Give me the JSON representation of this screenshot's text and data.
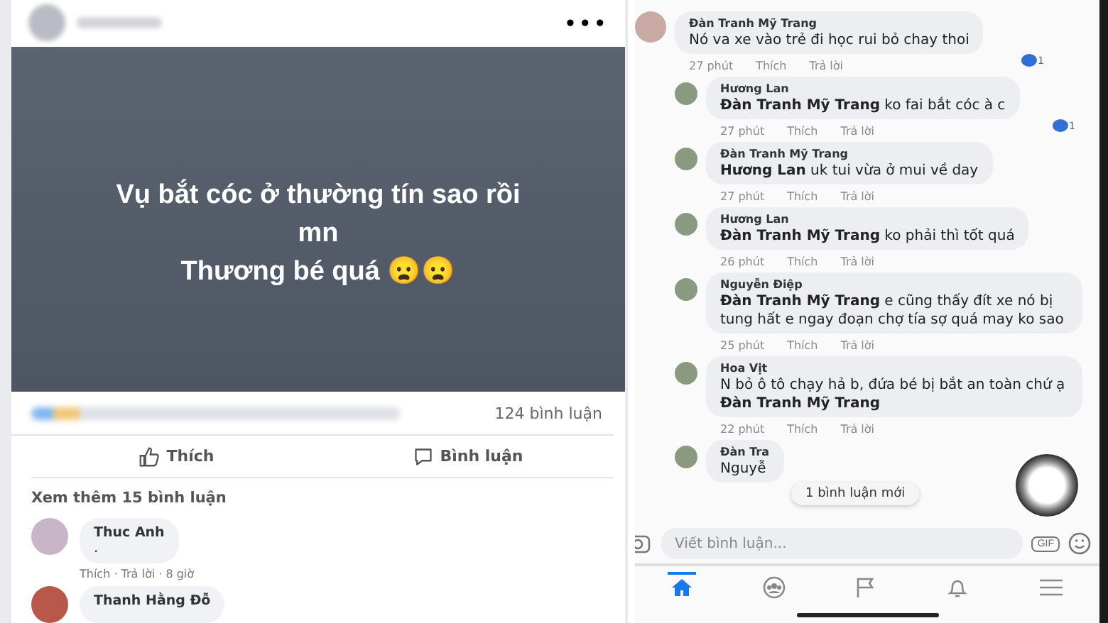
{
  "post": {
    "menu": "•••",
    "text_lines": [
      "Vụ bắt cóc ở thường tín sao rồi",
      "mn",
      "Thương bé quá 😦😦"
    ],
    "comment_count": "124 bình luận",
    "actions": [
      {
        "kind": "like",
        "label": "Thích"
      },
      {
        "kind": "comment",
        "label": "Bình luận"
      }
    ],
    "more_comments": "Xem thêm 15 bình luận",
    "comments": [
      {
        "name": "Thuc Anh",
        "text": ".",
        "meta": "Thích · Trả lời · 8 giờ"
      },
      {
        "name": "Thanh Hằng Đỗ"
      }
    ]
  },
  "thread": {
    "comments": [
      {
        "name": "Đàn Tranh Mỹ Trang",
        "text": "Nó va xe vào trẻ đi học rui bỏ chay thoi",
        "time": "27 phút",
        "like": "Thích",
        "reply": "Trả lời",
        "reactions": "1",
        "children": [
          {
            "name": "Hương Lan",
            "text": "**Đàn Tranh Mỹ Trang** ko fai bắt cóc à c",
            "time": "27 phút",
            "like": "Thích",
            "reply": "Trả lời",
            "reactions": "1"
          },
          {
            "name": "Đàn Tranh Mỹ Trang",
            "text": "**Hương Lan** uk tui vừa ở mui về day",
            "time": "27 phút",
            "like": "Thích",
            "reply": "Trả lời"
          },
          {
            "name": "Hương Lan",
            "text": "**Đàn Tranh Mỹ Trang** ko phải thì tốt quá",
            "time": "26 phút",
            "like": "Thích",
            "reply": "Trả lời"
          },
          {
            "name": "Nguyễn Điệp",
            "text": "**Đàn Tranh Mỹ Trang** e cũng thấy đít xe nó bị tung hất e ngay đoạn chợ tía sợ quá may ko sao",
            "time": "25 phút",
            "like": "Thích",
            "reply": "Trả lời"
          },
          {
            "name": "Hoa Vịt",
            "text": "N bỏ ô tô chạy hả b, đứa bé bị bắt an toàn chứ ạ **Đàn Tranh Mỹ Trang**",
            "time": "22 phút",
            "like": "Thích",
            "reply": "Trả lời"
          },
          {
            "name": "Đàn Tra",
            "text": "Nguyễ"
          }
        ]
      }
    ],
    "new_comments": "1 bình luận mới",
    "composer": {
      "placeholder": "Viết bình luận...",
      "gif": "GIF"
    },
    "nav": [
      {
        "kind": "home",
        "selected": true
      },
      {
        "kind": "groups",
        "selected": false
      },
      {
        "kind": "pages",
        "selected": false
      },
      {
        "kind": "notifications",
        "selected": false
      },
      {
        "kind": "menu",
        "selected": false
      }
    ]
  }
}
